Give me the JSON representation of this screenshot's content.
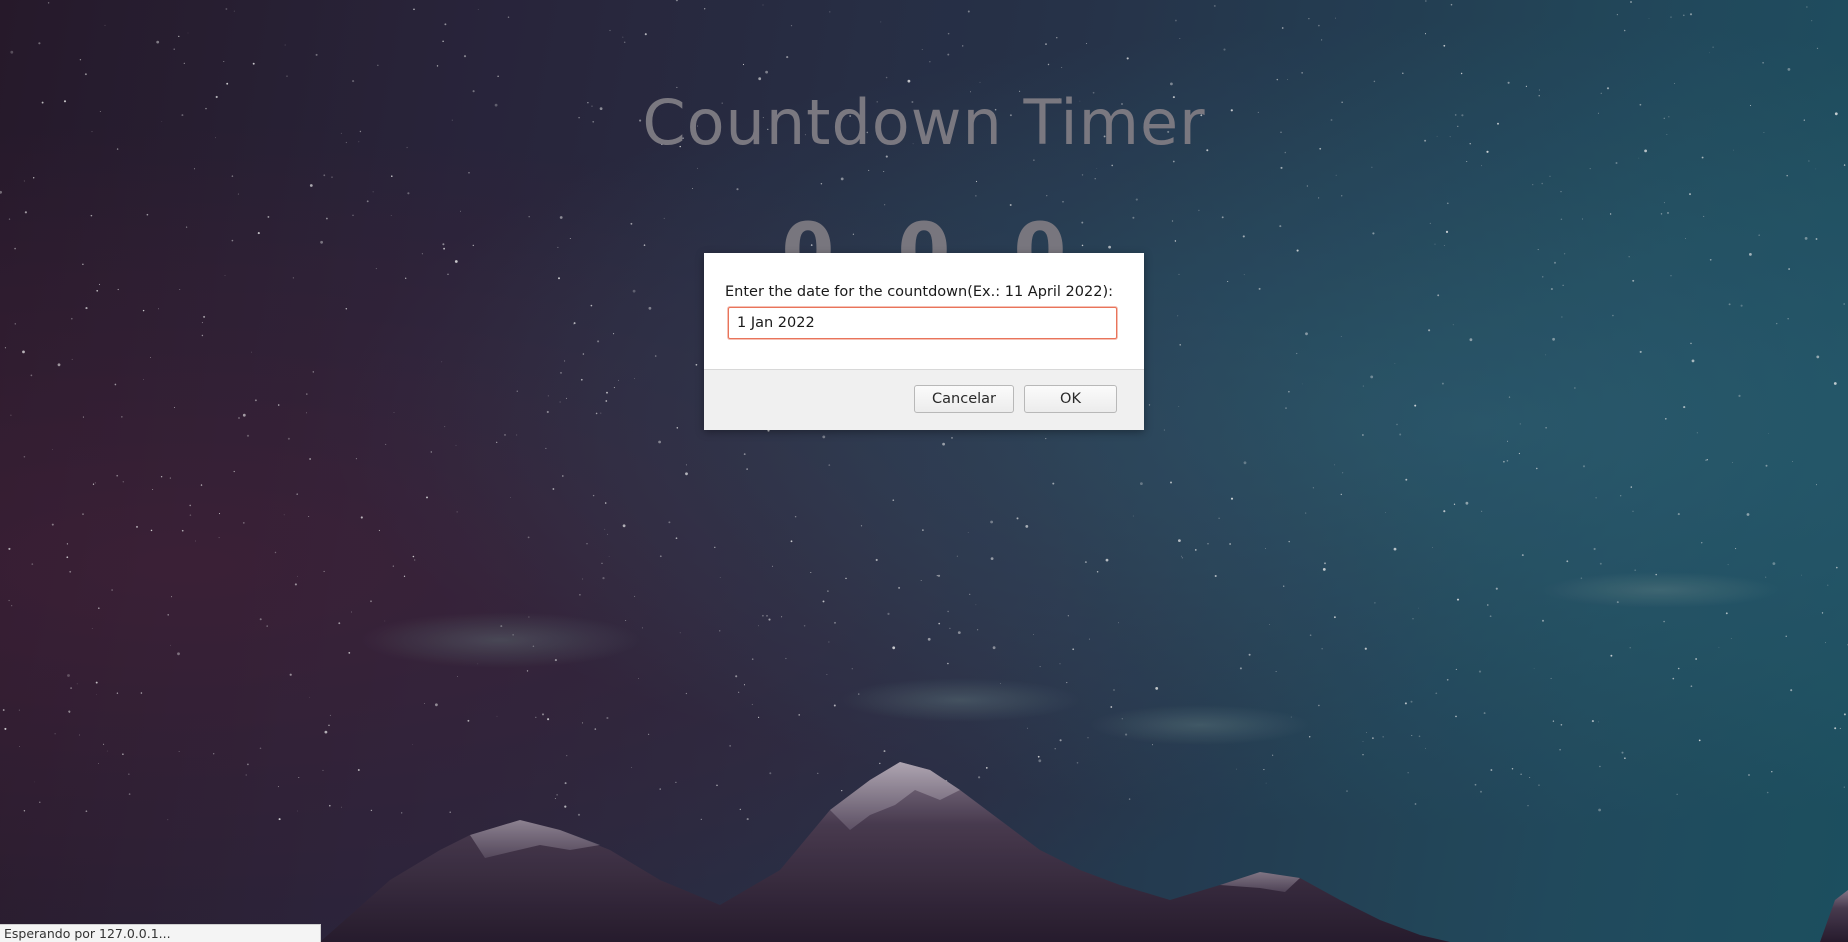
{
  "app": {
    "title": "Countdown Timer",
    "counter_values": [
      "0",
      "0",
      "0"
    ]
  },
  "prompt_dialog": {
    "message": "Enter the date for the countdown(Ex.: 11 April 2022):",
    "input_value": "1 Jan 2022",
    "cancel_label": "Cancelar",
    "ok_label": "OK",
    "input_focus_color": "#e9745a"
  },
  "status_bar": {
    "text": "Esperando por 127.0.0.1..."
  },
  "colors": {
    "background_left": "#2a1c2e",
    "background_right": "#1f5668",
    "title_text": "#7a7880"
  }
}
